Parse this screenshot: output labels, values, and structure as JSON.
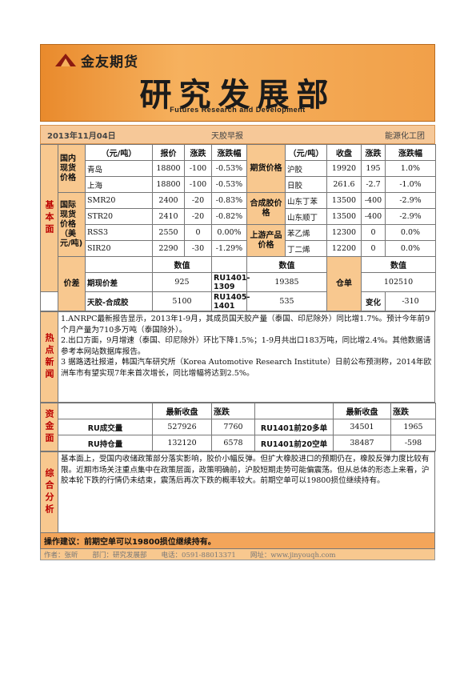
{
  "header": {
    "company": "金友期货",
    "title": "研究发展部",
    "subtitle": "Futures Research and Development"
  },
  "subhead": {
    "date": "2013年11月04日",
    "report": "天胶早报",
    "team": "能源化工团"
  },
  "basic": {
    "section_label": "基本面",
    "col_unit": "（元/吨）",
    "col_price": "报价",
    "col_change": "涨跌",
    "col_pct": "涨跌幅",
    "col_close": "收盘",
    "domestic_label": "国内现货价格",
    "intl_label": "国际现货价格（美元/吨)",
    "futures_label": "期货价格",
    "synth_label": "合成胶价格",
    "upstream_label": "上游产品价格",
    "left_rows": [
      {
        "name": "青岛",
        "price": "18800",
        "change": "-100",
        "pct": "-0.53%"
      },
      {
        "name": "上海",
        "price": "18800",
        "change": "-100",
        "pct": "-0.53%"
      },
      {
        "name": "SMR20",
        "price": "2400",
        "change": "-20",
        "pct": "-0.83%"
      },
      {
        "name": "STR20",
        "price": "2410",
        "change": "-20",
        "pct": "-0.82%"
      },
      {
        "name": "RSS3",
        "price": "2550",
        "change": "0",
        "pct": "0.00%"
      },
      {
        "name": "SIR20",
        "price": "2290",
        "change": "-30",
        "pct": "-1.29%"
      }
    ],
    "right_rows": [
      {
        "name": "沪胶",
        "close": "19920",
        "change": "195",
        "pct": "1.0%"
      },
      {
        "name": "日胶",
        "close": "261.6",
        "change": "-2.7",
        "pct": "-1.0%"
      },
      {
        "name": "山东丁苯",
        "close": "13500",
        "change": "-400",
        "pct": "-2.9%"
      },
      {
        "name": "山东顺丁",
        "close": "13500",
        "change": "-400",
        "pct": "-2.9%"
      },
      {
        "name": "苯乙烯",
        "close": "12300",
        "change": "0",
        "pct": "0.0%"
      },
      {
        "name": "丁二烯",
        "close": "12200",
        "change": "0",
        "pct": "0.0%"
      }
    ],
    "spread_label": "价差",
    "value_header": "数值",
    "spot_futures_label": "期现价差",
    "spot_futures_value": "925",
    "contract1_label": "RU1401-1309",
    "contract1_value": "19385",
    "natural_synth_label": "天胶-合成胶",
    "natural_synth_value": "5100",
    "contract2_label": "RU1405-1401",
    "contract2_value": "535",
    "warehouse_label": "仓单",
    "warehouse_value": "102510",
    "change_label": "变化",
    "change_value": "-310"
  },
  "news": {
    "section_label": "热点新闻",
    "items": [
      "1.ANRPC最新报告显示，2013年1-9月，其成员国天胶产量（泰国、印尼除外）同比增1.7%。预计今年前9个月产量为710多万吨（泰国除外）。",
      "2.出口方面，9月增速（泰国、印尼除外）环比下降1.5%；1-9月共出口183万吨，同比增2.4%。其他数据请参考本网站数据库报告。",
      "3 据路透社报道，韩国汽车研究所（Korea Automotive Research Institute）日前公布预测称，2014年欧洲车市有望实现7年来首次增长，同比增幅将达到2.5%。"
    ]
  },
  "funds": {
    "section_label": "资金面",
    "col_latest_close": "最新收盘",
    "col_change": "涨跌",
    "rows": [
      {
        "left_name": "RU成交量",
        "left_close": "527926",
        "left_change": "7760",
        "right_name": "RU1401前20多单",
        "right_close": "34501",
        "right_change": "1965"
      },
      {
        "left_name": "RU持仓量",
        "left_close": "132120",
        "left_change": "6578",
        "right_name": "RU1401前20空单",
        "right_close": "38487",
        "right_change": "-598"
      }
    ]
  },
  "analysis": {
    "section_label": "综合分析",
    "text": "基本面上，受国内收储政策部分落实影响，胶价小幅反弹。但扩大橡胶进口的预期仍在，橡胶反弹力度比较有限。近期市场关注重点集中在政策层面，政策明确前，沪胶短期走势可能偏震荡。但从总体的形态上来看，沪胶本轮下跌的行情仍未结束，震荡后再次下跌的概率较大。前期空单可以19800损位继续持有。"
  },
  "advice": "操作建议：前期空单可以19800损位继续持有。",
  "footer": {
    "author": "作者：张昕",
    "dept": "部门：研究发展部",
    "phone": "电话：0591-88013371",
    "site": "网址：www.jinyouqh.com"
  }
}
